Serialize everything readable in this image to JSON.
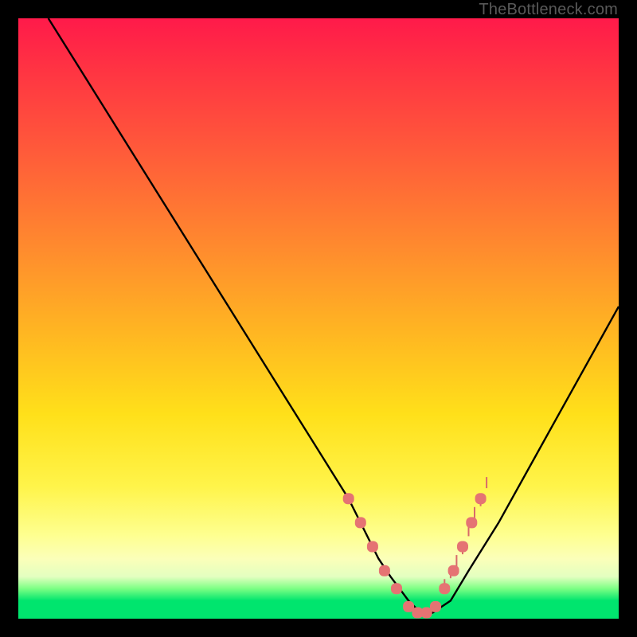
{
  "watermark": "TheBottleneck.com",
  "chart_data": {
    "type": "line",
    "title": "",
    "xlabel": "",
    "ylabel": "",
    "xlim": [
      0,
      100
    ],
    "ylim": [
      0,
      100
    ],
    "series": [
      {
        "name": "bottleneck-curve",
        "x": [
          5,
          10,
          15,
          20,
          25,
          30,
          35,
          40,
          45,
          50,
          55,
          57,
          60,
          62,
          65,
          67,
          69,
          72,
          75,
          80,
          85,
          90,
          95,
          100
        ],
        "values": [
          100,
          92,
          84,
          76,
          68,
          60,
          52,
          44,
          36,
          28,
          20,
          16,
          10,
          7,
          3,
          1,
          1,
          3,
          8,
          16,
          25,
          34,
          43,
          52
        ]
      }
    ],
    "markers": {
      "name": "highlight-points",
      "x": [
        55,
        57,
        59,
        61,
        63,
        65,
        66.5,
        68,
        69.5,
        71,
        72.5,
        74,
        75.5,
        77
      ],
      "values": [
        20,
        16,
        12,
        8,
        5,
        2,
        1,
        1,
        2,
        5,
        8,
        12,
        16,
        20
      ]
    },
    "hatch": {
      "name": "green-hatch-right",
      "x": [
        71,
        72,
        73,
        74,
        75,
        76,
        77,
        78
      ],
      "values": [
        5,
        7,
        9,
        11,
        14,
        17,
        19,
        22
      ]
    }
  }
}
